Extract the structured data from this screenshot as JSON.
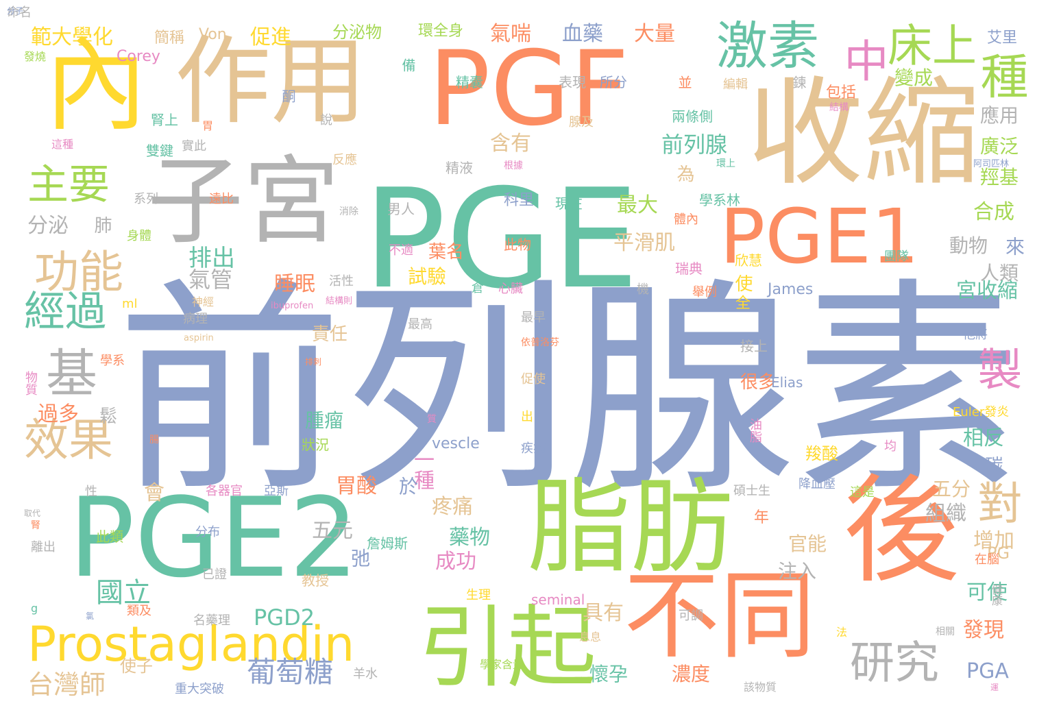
{
  "palette": [
    "#8da0cb",
    "#66c2a5",
    "#fc8d62",
    "#a6d854",
    "#e5c494",
    "#ffd92f",
    "#b3b3b3",
    "#e78ac3"
  ],
  "words": [
    {
      "text": "前列腺素",
      "size": 330,
      "color": "#8da0cb"
    },
    {
      "text": "PGE",
      "size": 200,
      "color": "#66c2a5"
    },
    {
      "text": "PGF",
      "size": 150,
      "color": "#fc8d62"
    },
    {
      "text": "收縮",
      "size": 170,
      "color": "#e5c494"
    },
    {
      "text": "PGE2",
      "size": 160,
      "color": "#66c2a5"
    },
    {
      "text": "脂肪",
      "size": 150,
      "color": "#a6d854"
    },
    {
      "text": "作用",
      "size": 140,
      "color": "#e5c494"
    },
    {
      "text": "子宮",
      "size": 140,
      "color": "#b3b3b3"
    },
    {
      "text": "後",
      "size": 170,
      "color": "#fc8d62"
    },
    {
      "text": "不同",
      "size": 140,
      "color": "#fc8d62"
    },
    {
      "text": "引起",
      "size": 130,
      "color": "#a6d854"
    },
    {
      "text": "PGE1",
      "size": 110,
      "color": "#fc8d62"
    },
    {
      "text": "內",
      "size": 150,
      "color": "#ffd92f"
    },
    {
      "text": "激素",
      "size": 75,
      "color": "#66c2a5"
    },
    {
      "text": "Prostaglandin",
      "size": 70,
      "color": "#ffd92f"
    },
    {
      "text": "床上",
      "size": 65,
      "color": "#a6d854"
    },
    {
      "text": "種",
      "size": 70,
      "color": "#a6d854"
    },
    {
      "text": "中",
      "size": 65,
      "color": "#e78ac3"
    },
    {
      "text": "研究",
      "size": 65,
      "color": "#b3b3b3"
    },
    {
      "text": "功能",
      "size": 65,
      "color": "#e5c494"
    },
    {
      "text": "效果",
      "size": 65,
      "color": "#e5c494"
    },
    {
      "text": "主要",
      "size": 60,
      "color": "#a6d854"
    },
    {
      "text": "經過",
      "size": 60,
      "color": "#66c2a5"
    },
    {
      "text": "基",
      "size": 75,
      "color": "#b3b3b3"
    },
    {
      "text": "製",
      "size": 65,
      "color": "#e78ac3"
    },
    {
      "text": "對",
      "size": 65,
      "color": "#e5c494"
    },
    {
      "text": "葡萄糖",
      "size": 42,
      "color": "#8da0cb"
    },
    {
      "text": "國立",
      "size": 40,
      "color": "#66c2a5"
    },
    {
      "text": "台灣師",
      "size": 38,
      "color": "#e5c494"
    },
    {
      "text": "PGD2",
      "size": 32,
      "color": "#66c2a5"
    },
    {
      "text": "前列腺",
      "size": 32,
      "color": "#66c2a5"
    },
    {
      "text": "平滑肌",
      "size": 30,
      "color": "#e5c494"
    },
    {
      "text": "最大",
      "size": 30,
      "color": "#a6d854"
    },
    {
      "text": "排出",
      "size": 34,
      "color": "#66c2a5"
    },
    {
      "text": "氣管",
      "size": 32,
      "color": "#b3b3b3"
    },
    {
      "text": "睡眠",
      "size": 30,
      "color": "#fc8d62"
    },
    {
      "text": "含有",
      "size": 30,
      "color": "#e5c494"
    },
    {
      "text": "氣喘",
      "size": 30,
      "color": "#fc8d62"
    },
    {
      "text": "血藥",
      "size": 30,
      "color": "#8da0cb"
    },
    {
      "text": "大量",
      "size": 30,
      "color": "#fc8d62"
    },
    {
      "text": "促進",
      "size": 30,
      "color": "#ffd92f"
    },
    {
      "text": "範大學化",
      "size": 30,
      "color": "#ffd92f"
    },
    {
      "text": "分泌物",
      "size": 24,
      "color": "#a6d854"
    },
    {
      "text": "環全身",
      "size": 22,
      "color": "#a6d854"
    },
    {
      "text": "變成",
      "size": 28,
      "color": "#a6d854"
    },
    {
      "text": "應用",
      "size": 28,
      "color": "#b3b3b3"
    },
    {
      "text": "廣泛",
      "size": 28,
      "color": "#a6d854"
    },
    {
      "text": "羥基",
      "size": 28,
      "color": "#a6d854"
    },
    {
      "text": "合成",
      "size": 30,
      "color": "#a6d854"
    },
    {
      "text": "動物",
      "size": 28,
      "color": "#b3b3b3"
    },
    {
      "text": "來",
      "size": 28,
      "color": "#8da0cb"
    },
    {
      "text": "人類",
      "size": 28,
      "color": "#b3b3b3"
    },
    {
      "text": "宮收縮",
      "size": 30,
      "color": "#66c2a5"
    },
    {
      "text": "相反",
      "size": 30,
      "color": "#66c2a5"
    },
    {
      "text": "五分",
      "size": 28,
      "color": "#e5c494"
    },
    {
      "text": "組織",
      "size": 30,
      "color": "#b3b3b3"
    },
    {
      "text": "增加",
      "size": 30,
      "color": "#e5c494"
    },
    {
      "text": "可使",
      "size": 30,
      "color": "#66c2a5"
    },
    {
      "text": "發現",
      "size": 30,
      "color": "#fc8d62"
    },
    {
      "text": "PGA",
      "size": 30,
      "color": "#8da0cb"
    },
    {
      "text": "PG",
      "size": 24,
      "color": "#e5c494"
    },
    {
      "text": "碳",
      "size": 26,
      "color": "#8da0cb"
    },
    {
      "text": "官能",
      "size": 28,
      "color": "#e5c494"
    },
    {
      "text": "注入",
      "size": 28,
      "color": "#b3b3b3"
    },
    {
      "text": "懷孕",
      "size": 28,
      "color": "#66c2a5"
    },
    {
      "text": "濃度",
      "size": 28,
      "color": "#fc8d62"
    },
    {
      "text": "具有",
      "size": 30,
      "color": "#e5c494"
    },
    {
      "text": "成功",
      "size": 30,
      "color": "#e78ac3"
    },
    {
      "text": "藥物",
      "size": 30,
      "color": "#66c2a5"
    },
    {
      "text": "疼痛",
      "size": 30,
      "color": "#e5c494"
    },
    {
      "text": "一種",
      "size": 30,
      "color": "#e78ac3"
    },
    {
      "text": "胃酸",
      "size": 30,
      "color": "#fc8d62"
    },
    {
      "text": "於",
      "size": 28,
      "color": "#8da0cb"
    },
    {
      "text": "五元",
      "size": 30,
      "color": "#b3b3b3"
    },
    {
      "text": "弛",
      "size": 28,
      "color": "#8da0cb"
    },
    {
      "text": "腫瘤",
      "size": 28,
      "color": "#66c2a5"
    },
    {
      "text": "責任",
      "size": 26,
      "color": "#e5c494"
    },
    {
      "text": "試驗",
      "size": 28,
      "color": "#ffd92f"
    },
    {
      "text": "葉名",
      "size": 26,
      "color": "#fc8d62"
    },
    {
      "text": "很多",
      "size": 26,
      "color": "#fc8d62"
    },
    {
      "text": "使",
      "size": 26,
      "color": "#ffd92f"
    },
    {
      "text": "為",
      "size": 26,
      "color": "#e5c494"
    },
    {
      "text": "過多",
      "size": 30,
      "color": "#fc8d62"
    },
    {
      "text": "鬆",
      "size": 26,
      "color": "#b3b3b3"
    },
    {
      "text": "會",
      "size": 30,
      "color": "#e5c494"
    },
    {
      "text": "分泌",
      "size": 30,
      "color": "#b3b3b3"
    },
    {
      "text": "肺",
      "size": 26,
      "color": "#b3b3b3"
    },
    {
      "text": "年",
      "size": 22,
      "color": "#fc8d62"
    },
    {
      "text": "全",
      "size": 22,
      "color": "#ffd92f"
    },
    {
      "text": "使子",
      "size": 24,
      "color": "#e5c494"
    },
    {
      "text": "羧酸",
      "size": 24,
      "color": "#ffd92f"
    },
    {
      "text": "Von",
      "size": 22,
      "color": "#e5c494"
    },
    {
      "text": "Corey",
      "size": 22,
      "color": "#e78ac3"
    },
    {
      "text": "James",
      "size": 22,
      "color": "#8da0cb"
    },
    {
      "text": "Elias",
      "size": 20,
      "color": "#8da0cb"
    },
    {
      "text": "Euler發炎",
      "size": 18,
      "color": "#ffd92f"
    },
    {
      "text": "vescle",
      "size": 22,
      "color": "#8da0cb"
    },
    {
      "text": "seminal",
      "size": 20,
      "color": "#e78ac3"
    },
    {
      "text": "ml",
      "size": 18,
      "color": "#ffd92f"
    },
    {
      "text": "ibuprofen",
      "size": 13,
      "color": "#e78ac3"
    },
    {
      "text": "aspirin",
      "size": 13,
      "color": "#e5c494"
    },
    {
      "text": "簡稱",
      "size": 22,
      "color": "#e5c494"
    },
    {
      "text": "發燒",
      "size": 16,
      "color": "#a6d854"
    },
    {
      "text": "腎上",
      "size": 20,
      "color": "#66c2a5"
    },
    {
      "text": "這種",
      "size": 16,
      "color": "#e78ac3"
    },
    {
      "text": "雙鍵",
      "size": 20,
      "color": "#66c2a5"
    },
    {
      "text": "胃",
      "size": 16,
      "color": "#fc8d62"
    },
    {
      "text": "實此",
      "size": 18,
      "color": "#b3b3b3"
    },
    {
      "text": "酮",
      "size": 20,
      "color": "#8da0cb"
    },
    {
      "text": "說",
      "size": 18,
      "color": "#b3b3b3"
    },
    {
      "text": "結構",
      "size": 14,
      "color": "#e78ac3"
    },
    {
      "text": "備",
      "size": 20,
      "color": "#66c2a5"
    },
    {
      "text": "精囊",
      "size": 20,
      "color": "#66c2a5"
    },
    {
      "text": "表現",
      "size": 20,
      "color": "#b3b3b3"
    },
    {
      "text": "所分",
      "size": 20,
      "color": "#8da0cb"
    },
    {
      "text": "並",
      "size": 20,
      "color": "#fc8d62"
    },
    {
      "text": "編輯",
      "size": 18,
      "color": "#e5c494"
    },
    {
      "text": "鍊",
      "size": 20,
      "color": "#b3b3b3"
    },
    {
      "text": "包括",
      "size": 22,
      "color": "#fc8d62"
    },
    {
      "text": "艾里",
      "size": 22,
      "color": "#8da0cb"
    },
    {
      "text": "腺及",
      "size": 18,
      "color": "#e5c494"
    },
    {
      "text": "兩條側",
      "size": 20,
      "color": "#66c2a5"
    },
    {
      "text": "精液",
      "size": 20,
      "color": "#b3b3b3"
    },
    {
      "text": "根據",
      "size": 14,
      "color": "#e78ac3"
    },
    {
      "text": "反應",
      "size": 18,
      "color": "#e5c494"
    },
    {
      "text": "環上",
      "size": 14,
      "color": "#66c2a5"
    },
    {
      "text": "阿司匹林",
      "size": 13,
      "color": "#8da0cb"
    },
    {
      "text": "系列",
      "size": 18,
      "color": "#b3b3b3"
    },
    {
      "text": "遠比",
      "size": 18,
      "color": "#fc8d62"
    },
    {
      "text": "科里",
      "size": 22,
      "color": "#8da0cb"
    },
    {
      "text": "現在",
      "size": 20,
      "color": "#66c2a5"
    },
    {
      "text": "學系林",
      "size": 20,
      "color": "#66c2a5"
    },
    {
      "text": "消除",
      "size": 14,
      "color": "#b3b3b3"
    },
    {
      "text": "男人",
      "size": 20,
      "color": "#b3b3b3"
    },
    {
      "text": "身體",
      "size": 18,
      "color": "#a6d854"
    },
    {
      "text": "體內",
      "size": 18,
      "color": "#fc8d62"
    },
    {
      "text": "不適",
      "size": 18,
      "color": "#e78ac3"
    },
    {
      "text": "此物",
      "size": 20,
      "color": "#fc8d62"
    },
    {
      "text": "團隊",
      "size": 18,
      "color": "#66c2a5"
    },
    {
      "text": "欣慧",
      "size": 20,
      "color": "#ffd92f"
    },
    {
      "text": "瑞典",
      "size": 20,
      "color": "#e78ac3"
    },
    {
      "text": "活性",
      "size": 18,
      "color": "#b3b3b3"
    },
    {
      "text": "倉",
      "size": 18,
      "color": "#66c2a5"
    },
    {
      "text": "心臟",
      "size": 18,
      "color": "#e78ac3"
    },
    {
      "text": "機",
      "size": 18,
      "color": "#b3b3b3"
    },
    {
      "text": "舉例",
      "size": 18,
      "color": "#fc8d62"
    },
    {
      "text": "神經",
      "size": 16,
      "color": "#e5c494"
    },
    {
      "text": "結構則",
      "size": 13,
      "color": "#e78ac3"
    },
    {
      "text": "最高",
      "size": 18,
      "color": "#b3b3b3"
    },
    {
      "text": "最早",
      "size": 18,
      "color": "#b3b3b3"
    },
    {
      "text": "接上",
      "size": 20,
      "color": "#b3b3b3"
    },
    {
      "text": "病理",
      "size": 18,
      "color": "#b3b3b3"
    },
    {
      "text": "依普洛芬",
      "size": 14,
      "color": "#fc8d62"
    },
    {
      "text": "他將",
      "size": 18,
      "color": "#8da0cb"
    },
    {
      "text": "學系",
      "size": 18,
      "color": "#fc8d62"
    },
    {
      "text": "排刺",
      "size": 12,
      "color": "#fc8d62"
    },
    {
      "text": "促使",
      "size": 18,
      "color": "#e5c494"
    },
    {
      "text": "物質",
      "size": 18,
      "color": "#e78ac3"
    },
    {
      "text": "質",
      "size": 14,
      "color": "#e78ac3"
    },
    {
      "text": "出",
      "size": 18,
      "color": "#ffd92f"
    },
    {
      "text": "油脂",
      "size": 18,
      "color": "#e78ac3"
    },
    {
      "text": "腸",
      "size": 14,
      "color": "#fc8d62"
    },
    {
      "text": "狀況",
      "size": 20,
      "color": "#a6d854"
    },
    {
      "text": "疾病",
      "size": 18,
      "color": "#8da0cb"
    },
    {
      "text": "均",
      "size": 18,
      "color": "#e78ac3"
    },
    {
      "text": "性",
      "size": 18,
      "color": "#b3b3b3"
    },
    {
      "text": "各器官",
      "size": 18,
      "color": "#e78ac3"
    },
    {
      "text": "亞斯",
      "size": 18,
      "color": "#8da0cb"
    },
    {
      "text": "碩士生",
      "size": 18,
      "color": "#b3b3b3"
    },
    {
      "text": "降血壓",
      "size": 18,
      "color": "#8da0cb"
    },
    {
      "text": "這是",
      "size": 18,
      "color": "#a6d854"
    },
    {
      "text": "取代",
      "size": 12,
      "color": "#b3b3b3"
    },
    {
      "text": "腎",
      "size": 14,
      "color": "#fc8d62"
    },
    {
      "text": "此類",
      "size": 20,
      "color": "#a6d854"
    },
    {
      "text": "分布",
      "size": 18,
      "color": "#8da0cb"
    },
    {
      "text": "詹姆斯",
      "size": 20,
      "color": "#66c2a5"
    },
    {
      "text": "離出",
      "size": 18,
      "color": "#b3b3b3"
    },
    {
      "text": "已證",
      "size": 18,
      "color": "#b3b3b3"
    },
    {
      "text": "教授",
      "size": 20,
      "color": "#e5c494"
    },
    {
      "text": "在腦",
      "size": 18,
      "color": "#fc8d62"
    },
    {
      "text": "健康",
      "size": 16,
      "color": "#b3b3b3"
    },
    {
      "text": "g",
      "size": 16,
      "color": "#66c2a5"
    },
    {
      "text": "氯",
      "size": 12,
      "color": "#8da0cb"
    },
    {
      "text": "類及",
      "size": 18,
      "color": "#fc8d62"
    },
    {
      "text": "生理",
      "size": 18,
      "color": "#ffd92f"
    },
    {
      "text": "名藥理",
      "size": 18,
      "color": "#b3b3b3"
    },
    {
      "text": "可調",
      "size": 18,
      "color": "#b3b3b3"
    },
    {
      "text": "息息",
      "size": 16,
      "color": "#e5c494"
    },
    {
      "text": "法",
      "size": 16,
      "color": "#ffd92f"
    },
    {
      "text": "相關",
      "size": 14,
      "color": "#b3b3b3"
    },
    {
      "text": "重大突破",
      "size": 18,
      "color": "#8da0cb"
    },
    {
      "text": "羊水",
      "size": 18,
      "color": "#b3b3b3"
    },
    {
      "text": "學家含量",
      "size": 16,
      "color": "#a6d854"
    },
    {
      "text": "該物質",
      "size": 16,
      "color": "#b3b3b3"
    },
    {
      "text": "運",
      "size": 12,
      "color": "#e78ac3"
    },
    {
      "text": "命名",
      "size": 18,
      "color": "#b3b3b3"
    },
    {
      "text": "分子",
      "size": 12,
      "color": "#8da0cb"
    }
  ]
}
